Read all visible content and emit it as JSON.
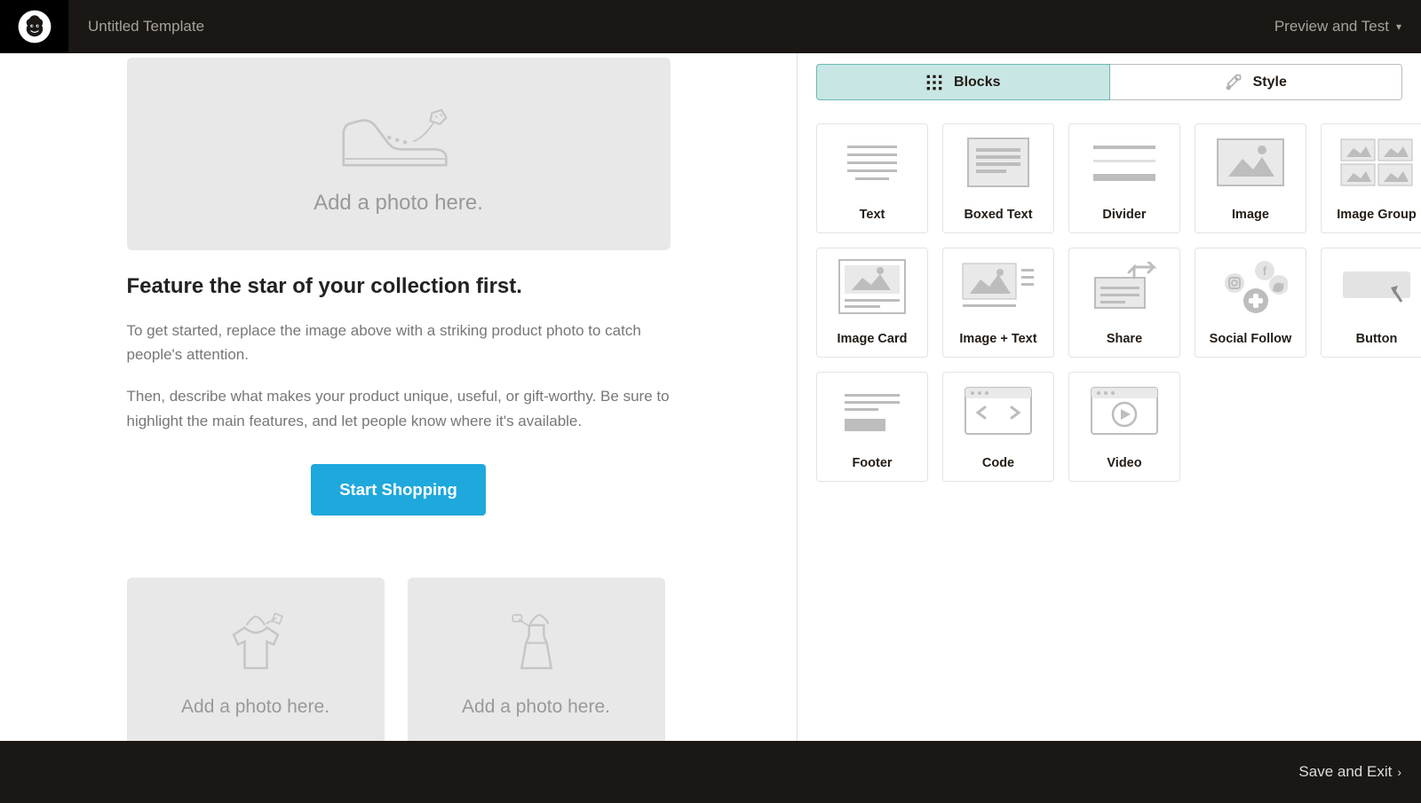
{
  "topbar": {
    "template_name": "Untitled Template",
    "preview": "Preview and Test"
  },
  "email": {
    "hero_label": "Add a photo here.",
    "headline": "Feature the star of your collection first.",
    "p1": "To get started, replace the image above with a striking product photo to catch people's attention.",
    "p2": "Then, describe what makes your product unique, useful, or gift-worthy. Be sure to highlight the main features, and let people know where it's available.",
    "cta": "Start Shopping",
    "small1": "Add a photo here.",
    "small2": "Add a photo here."
  },
  "side": {
    "tab_blocks": "Blocks",
    "tab_style": "Style",
    "blocks": [
      {
        "id": "text",
        "label": "Text"
      },
      {
        "id": "boxed-text",
        "label": "Boxed Text"
      },
      {
        "id": "divider",
        "label": "Divider"
      },
      {
        "id": "image",
        "label": "Image"
      },
      {
        "id": "image-group",
        "label": "Image Group"
      },
      {
        "id": "image-card",
        "label": "Image Card"
      },
      {
        "id": "image-text",
        "label": "Image + Text"
      },
      {
        "id": "share",
        "label": "Share"
      },
      {
        "id": "social-follow",
        "label": "Social Follow"
      },
      {
        "id": "button",
        "label": "Button"
      },
      {
        "id": "footer",
        "label": "Footer"
      },
      {
        "id": "code",
        "label": "Code"
      },
      {
        "id": "video",
        "label": "Video"
      }
    ]
  },
  "footer": {
    "save": "Save and Exit"
  }
}
